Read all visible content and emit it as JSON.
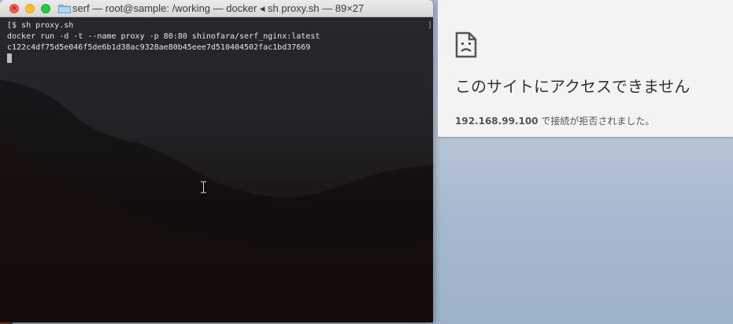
{
  "terminal": {
    "title": "serf — root@sample: /working — docker ◂ sh proxy.sh — 89×27",
    "lines": [
      "[$ sh proxy.sh",
      "docker run -d -t --name proxy -p 80:80 shinofara/serf_nginx:latest",
      "c122c4df75d5e046f5de6b1d38ac9328ae80b45eee7d510404502fac1bd37669"
    ],
    "scroll_marker": "]"
  },
  "browser_error": {
    "icon": "sad-page-icon",
    "title": "このサイトにアクセスできません",
    "host": "192.168.99.100",
    "message": " で接続が拒否されました。"
  },
  "colors": {
    "close": "#fc5f57",
    "minimize": "#fdbc2e",
    "maximize": "#28c840"
  }
}
